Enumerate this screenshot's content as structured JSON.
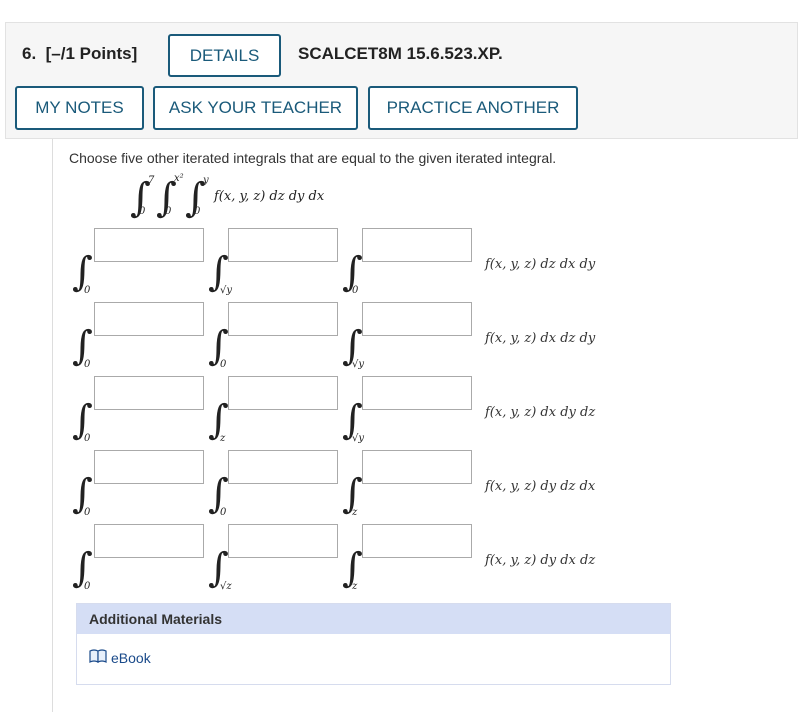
{
  "header": {
    "question_number": "6.",
    "points": "[–/1 Points]",
    "details_label": "DETAILS",
    "code": "SCALCET8M 15.6.523.XP.",
    "my_notes_label": "MY NOTES",
    "ask_teacher_label": "ASK YOUR TEACHER",
    "practice_label": "PRACTICE ANOTHER"
  },
  "question": {
    "prompt": "Choose five other iterated integrals that are equal to the given iterated integral.",
    "given": {
      "outer_upper": "7",
      "outer_lower": "0",
      "middle_upper": "x²",
      "middle_lower": "0",
      "inner_upper": "y",
      "inner_lower": "0",
      "integrand": "f(x, y, z) dz dy dx"
    },
    "rows": [
      {
        "lowers": [
          "0",
          "√y",
          "0"
        ],
        "integrand": "f(x, y, z) dz dx dy"
      },
      {
        "lowers": [
          "0",
          "0",
          "√y"
        ],
        "integrand": "f(x, y, z) dx dz dy"
      },
      {
        "lowers": [
          "0",
          "z",
          "√y"
        ],
        "integrand": "f(x, y, z) dx dy dz"
      },
      {
        "lowers": [
          "0",
          "0",
          "z"
        ],
        "integrand": "f(x, y, z) dy dz dx"
      },
      {
        "lowers": [
          "0",
          "√z",
          "z"
        ],
        "integrand": "f(x, y, z) dy dx dz"
      }
    ]
  },
  "additional_materials": {
    "title": "Additional Materials",
    "ebook_label": "eBook",
    "icon": "book-icon"
  },
  "colors": {
    "accent": "#1a5a7a",
    "header_bg": "#f6f6f6",
    "materials_bg": "#d5def5",
    "link": "#1a4a8a"
  }
}
